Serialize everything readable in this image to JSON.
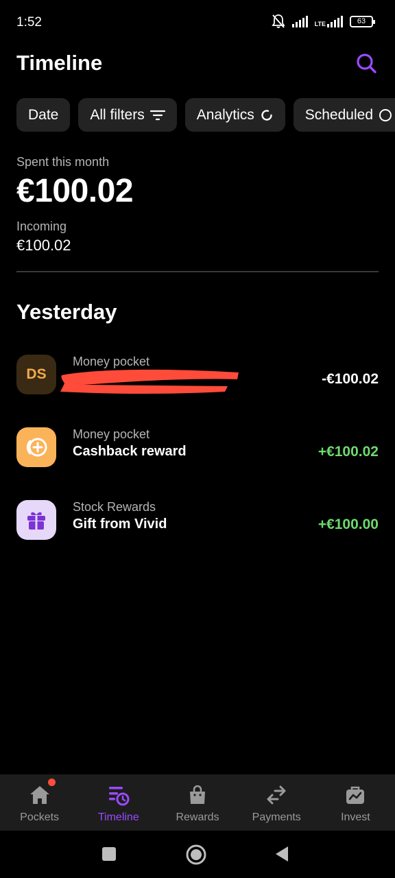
{
  "status": {
    "time": "1:52",
    "network": "LTE",
    "battery": "63"
  },
  "header": {
    "title": "Timeline"
  },
  "filters": [
    {
      "label": "Date"
    },
    {
      "label": "All filters"
    },
    {
      "label": "Analytics"
    },
    {
      "label": "Scheduled"
    }
  ],
  "summary": {
    "spent_label": "Spent this month",
    "spent_value": "€100.02",
    "incoming_label": "Incoming",
    "incoming_value": "€100.02"
  },
  "section": {
    "title": "Yesterday"
  },
  "transactions": [
    {
      "avatar_text": "DS",
      "category": "Money pocket",
      "name": "",
      "amount": "-€100.02"
    },
    {
      "category": "Money pocket",
      "name": "Cashback reward",
      "amount": "+€100.02"
    },
    {
      "category": "Stock Rewards",
      "name": "Gift from Vivid",
      "amount": "+€100.00"
    }
  ],
  "nav": [
    {
      "label": "Pockets",
      "icon": "home-icon"
    },
    {
      "label": "Timeline",
      "icon": "timeline-icon"
    },
    {
      "label": "Rewards",
      "icon": "bag-icon"
    },
    {
      "label": "Payments",
      "icon": "transfer-arrows-icon"
    },
    {
      "label": "Invest",
      "icon": "briefcase-chart-icon"
    }
  ],
  "colors": {
    "accent": "#9a4bff",
    "positive": "#6fd96f",
    "chip_bg": "#232323",
    "nav_bg": "#1d1d1d",
    "badge": "#ff4d3d"
  }
}
